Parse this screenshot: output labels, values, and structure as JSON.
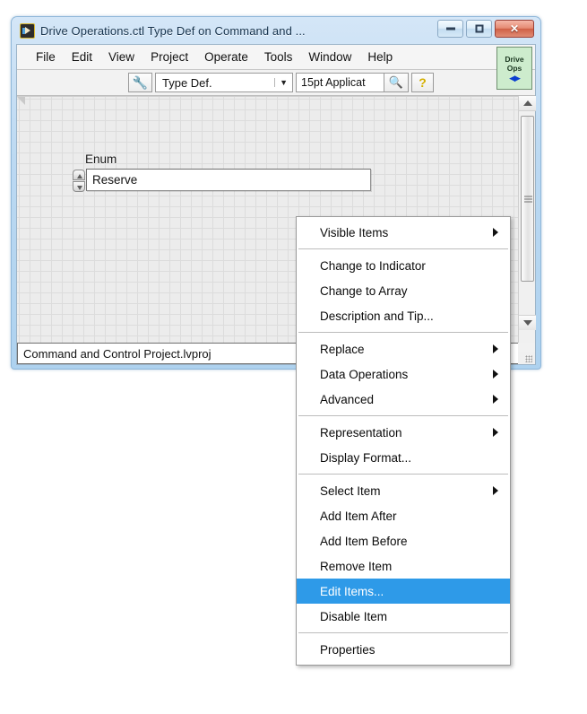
{
  "window": {
    "title": "Drive Operations.ctl Type Def on Command and ...",
    "app_icon": "labview-icon",
    "buttons": {
      "minimize": "minimize-icon",
      "restore": "restore-icon",
      "close": "✕"
    }
  },
  "menubar": {
    "items": [
      {
        "label": "File"
      },
      {
        "label": "Edit"
      },
      {
        "label": "View"
      },
      {
        "label": "Project"
      },
      {
        "label": "Operate"
      },
      {
        "label": "Tools"
      },
      {
        "label": "Window"
      },
      {
        "label": "Help"
      }
    ]
  },
  "connector_pane": {
    "line1": "Drive",
    "line2": "Ops",
    "arrows": "◀▶"
  },
  "toolbar": {
    "wrench_icon": "🔧",
    "typedef_value": "Type Def.",
    "typedef_caret": "▼",
    "font_value": "15pt Applicat",
    "zoom_icon": "🔍",
    "help_icon": "?"
  },
  "front_panel": {
    "enum_label": "Enum",
    "enum_value": "Reserve"
  },
  "statusbar": {
    "text": "Command and Control Project.lvproj"
  },
  "context_menu": {
    "groups": [
      {
        "items": [
          {
            "label": "Visible Items",
            "submenu": true,
            "selected": false
          }
        ]
      },
      {
        "items": [
          {
            "label": "Change to Indicator",
            "submenu": false,
            "selected": false
          },
          {
            "label": "Change to Array",
            "submenu": false,
            "selected": false
          },
          {
            "label": "Description and Tip...",
            "submenu": false,
            "selected": false
          }
        ]
      },
      {
        "items": [
          {
            "label": "Replace",
            "submenu": true,
            "selected": false
          },
          {
            "label": "Data Operations",
            "submenu": true,
            "selected": false
          },
          {
            "label": "Advanced",
            "submenu": true,
            "selected": false
          }
        ]
      },
      {
        "items": [
          {
            "label": "Representation",
            "submenu": true,
            "selected": false
          },
          {
            "label": "Display Format...",
            "submenu": false,
            "selected": false
          }
        ]
      },
      {
        "items": [
          {
            "label": "Select Item",
            "submenu": true,
            "selected": false
          },
          {
            "label": "Add Item After",
            "submenu": false,
            "selected": false
          },
          {
            "label": "Add Item Before",
            "submenu": false,
            "selected": false
          },
          {
            "label": "Remove Item",
            "submenu": false,
            "selected": false
          },
          {
            "label": "Edit Items...",
            "submenu": false,
            "selected": true
          },
          {
            "label": "Disable Item",
            "submenu": false,
            "selected": false
          }
        ]
      },
      {
        "items": [
          {
            "label": "Properties",
            "submenu": false,
            "selected": false
          }
        ]
      }
    ]
  },
  "colors": {
    "selection_blue": "#2e9ae8",
    "window_frame": "#bcd9f2",
    "connector_pane_green": "#cdeccd"
  }
}
